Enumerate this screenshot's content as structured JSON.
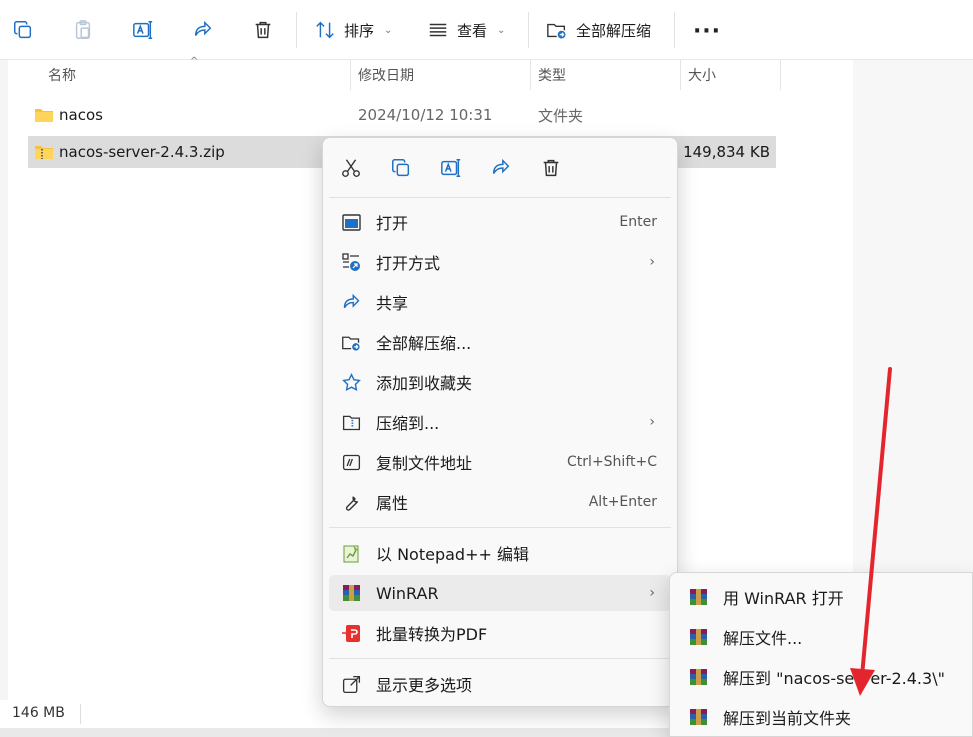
{
  "toolbar": {
    "sort_label": "排序",
    "view_label": "查看",
    "extract_all_label": "全部解压缩"
  },
  "columns": {
    "name": "名称",
    "modified": "修改日期",
    "type": "类型",
    "size": "大小"
  },
  "files": [
    {
      "name": "nacos",
      "modified": "2024/10/12 10:31",
      "type": "文件夹",
      "size": ""
    },
    {
      "name": "nacos-server-2.4.3.zip",
      "modified": "",
      "type": "",
      "size": "149,834 KB"
    }
  ],
  "status": {
    "size_text": "146 MB"
  },
  "context_menu": {
    "items": [
      {
        "label": "打开",
        "shortcut": "Enter",
        "icon": "open-icon"
      },
      {
        "label": "打开方式",
        "shortcut": "",
        "icon": "open-with-icon",
        "submenu": true
      },
      {
        "label": "共享",
        "shortcut": "",
        "icon": "share-icon"
      },
      {
        "label": "全部解压缩...",
        "shortcut": "",
        "icon": "extract-all-icon"
      },
      {
        "label": "添加到收藏夹",
        "shortcut": "",
        "icon": "star-icon"
      },
      {
        "label": "压缩到...",
        "shortcut": "",
        "icon": "compress-icon",
        "submenu": true
      },
      {
        "label": "复制文件地址",
        "shortcut": "Ctrl+Shift+C",
        "icon": "copy-path-icon"
      },
      {
        "label": "属性",
        "shortcut": "Alt+Enter",
        "icon": "wrench-icon"
      }
    ],
    "extra_items": [
      {
        "label": "以 Notepad++ 编辑",
        "icon": "notepadpp-icon"
      },
      {
        "label": "WinRAR",
        "icon": "winrar-icon",
        "submenu": true
      },
      {
        "label": "批量转换为PDF",
        "icon": "pdf-convert-icon"
      }
    ],
    "more_options": {
      "label": "显示更多选项",
      "icon": "more-options-icon"
    }
  },
  "winrar_submenu": {
    "items": [
      {
        "label": "用 WinRAR 打开"
      },
      {
        "label": "解压文件..."
      },
      {
        "label": "解压到 \"nacos-server-2.4.3\\\""
      },
      {
        "label": "解压到当前文件夹"
      }
    ]
  },
  "colors": {
    "accent": "#0067c0",
    "selection": "#dcdcdc",
    "annotation_arrow": "#e3262d",
    "folder": "#f4c440"
  }
}
